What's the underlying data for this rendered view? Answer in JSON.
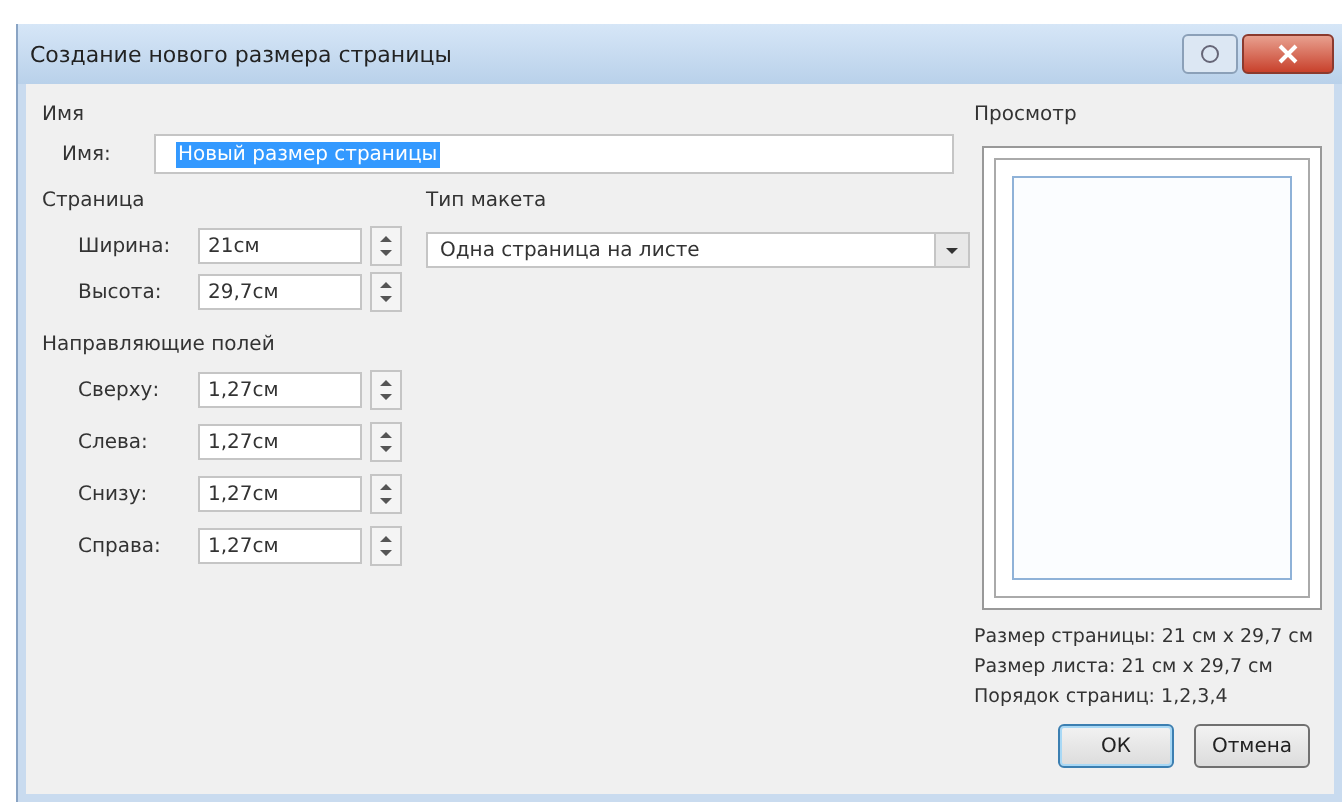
{
  "window": {
    "title": "Создание нового размера страницы"
  },
  "name_group": {
    "heading": "Имя",
    "label": "Имя:",
    "value": "Новый размер страницы",
    "value_selected": true
  },
  "page_group": {
    "heading": "Страница",
    "fields": [
      {
        "label": "Ширина:",
        "value": "21см"
      },
      {
        "label": "Высота:",
        "value": "29,7см"
      }
    ]
  },
  "layout_type": {
    "label": "Тип макета",
    "value": "Одна страница на листе"
  },
  "margins_group": {
    "heading": "Направляющие полей",
    "fields": [
      {
        "label": "Сверху:",
        "value": "1,27см"
      },
      {
        "label": "Слева:",
        "value": "1,27см"
      },
      {
        "label": "Снизу:",
        "value": "1,27см"
      },
      {
        "label": "Справа:",
        "value": "1,27см"
      }
    ]
  },
  "preview": {
    "heading": "Просмотр",
    "info": [
      "Размер страницы: 21 см x 29,7 см",
      "Размер листа: 21 см x 29,7 см",
      "Порядок страниц: 1,2,3,4"
    ]
  },
  "buttons": [
    {
      "label": "ОК",
      "default": true
    },
    {
      "label": "Отмена",
      "default": false
    }
  ]
}
